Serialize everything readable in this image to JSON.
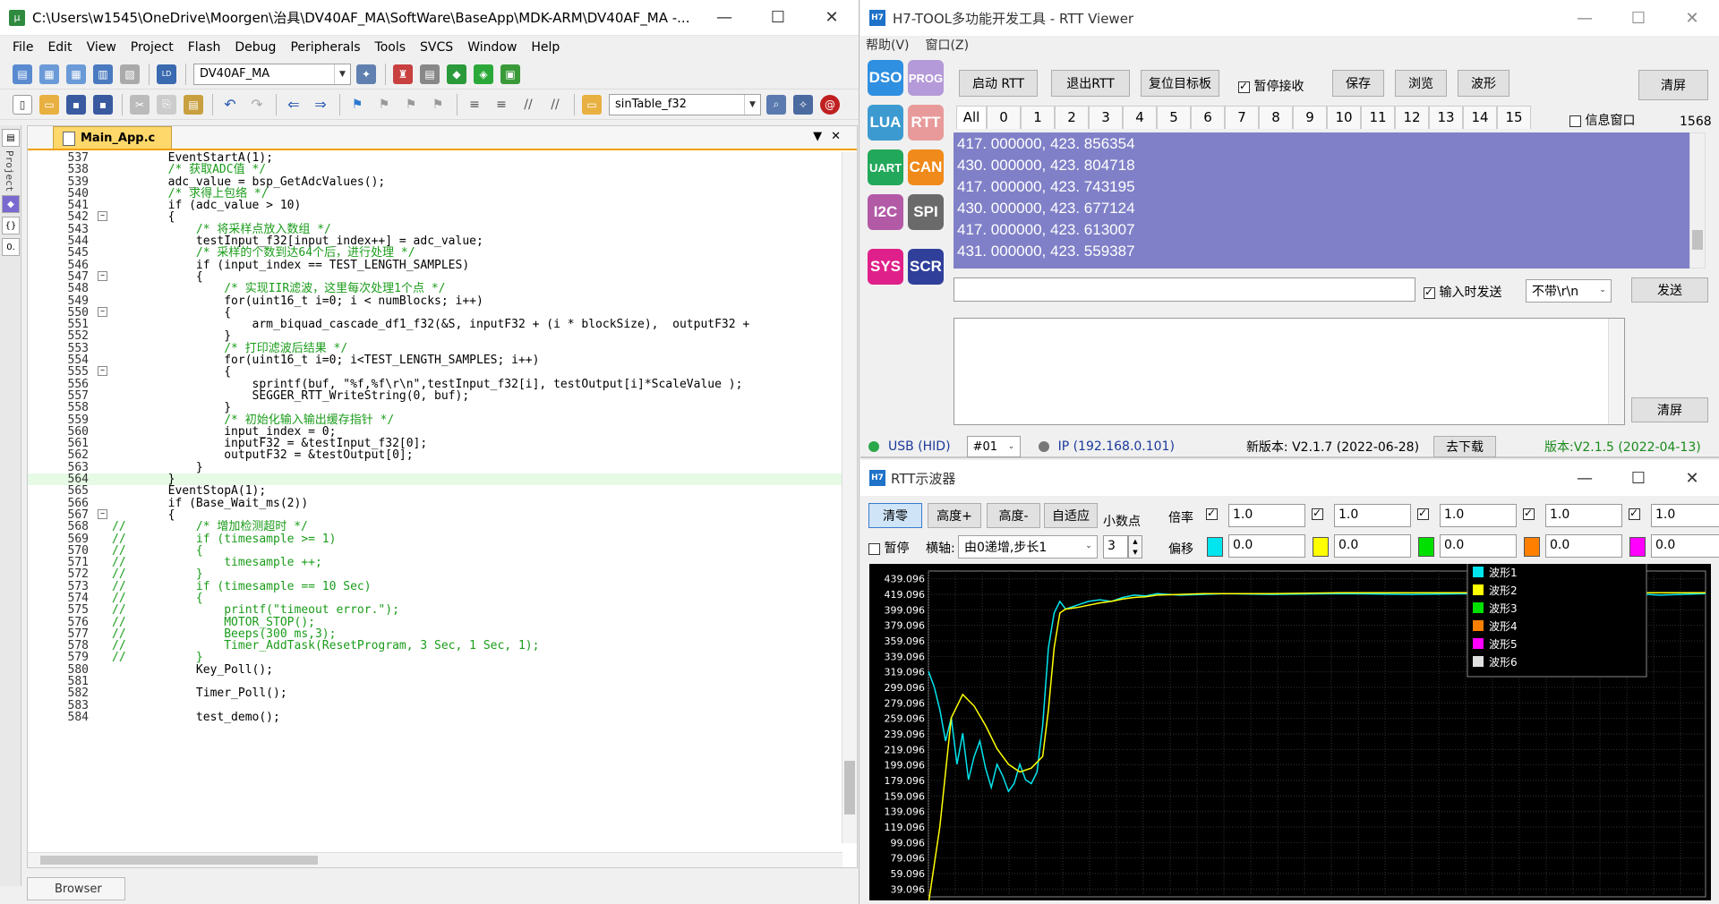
{
  "ide": {
    "title": "C:\\Users\\w1545\\OneDrive\\Moorgen\\治具\\DV40AF_MA\\SoftWare\\BaseApp\\MDK-ARM\\DV40AF_MA -...",
    "menu": [
      "File",
      "Edit",
      "View",
      "Project",
      "Flash",
      "Debug",
      "Peripherals",
      "Tools",
      "SVCS",
      "Window",
      "Help"
    ],
    "target": "DV40AF_MA",
    "find_combo": "sinTable_f32",
    "tab": "Main_App.c",
    "side_label": "Project",
    "browser_tab": "Browser",
    "code": [
      {
        "n": "537",
        "t": "        EventStartA(1);"
      },
      {
        "n": "538",
        "t": "        /* 获取ADC值 */"
      },
      {
        "n": "539",
        "t": "        adc_value = bsp_GetAdcValues();"
      },
      {
        "n": "540",
        "t": "        /* 求得上包络 */"
      },
      {
        "n": "541",
        "t": "        if (adc_value > 10)"
      },
      {
        "n": "542",
        "t": "        {",
        "f": 1
      },
      {
        "n": "543",
        "t": "            /* 将采样点放入数组 */"
      },
      {
        "n": "544",
        "t": "            testInput_f32[input_index++] = adc_value;"
      },
      {
        "n": "545",
        "t": "            /* 采样的个数到达64个后，进行处理 */"
      },
      {
        "n": "546",
        "t": "            if (input_index == TEST_LENGTH_SAMPLES)"
      },
      {
        "n": "547",
        "t": "            {",
        "f": 1
      },
      {
        "n": "548",
        "t": "                /* 实现IIR滤波，这里每次处理1个点 */"
      },
      {
        "n": "549",
        "t": "                for(uint16_t i=0; i < numBlocks; i++)"
      },
      {
        "n": "550",
        "t": "                {",
        "f": 1
      },
      {
        "n": "551",
        "t": "                    arm_biquad_cascade_df1_f32(&S, inputF32 + (i * blockSize),  outputF32 +"
      },
      {
        "n": "552",
        "t": "                }"
      },
      {
        "n": "553",
        "t": "                /* 打印滤波后结果 */"
      },
      {
        "n": "554",
        "t": "                for(uint16_t i=0; i<TEST_LENGTH_SAMPLES; i++)"
      },
      {
        "n": "555",
        "t": "                {",
        "f": 1
      },
      {
        "n": "556",
        "t": "                    sprintf(buf, \"%f,%f\\r\\n\",testInput_f32[i], testOutput[i]*ScaleValue );"
      },
      {
        "n": "557",
        "t": "                    SEGGER_RTT_WriteString(0, buf);"
      },
      {
        "n": "558",
        "t": "                }"
      },
      {
        "n": "559",
        "t": "                /* 初始化输入输出缓存指针 */"
      },
      {
        "n": "560",
        "t": "                input_index = 0;"
      },
      {
        "n": "561",
        "t": "                inputF32 = &testInput_f32[0];"
      },
      {
        "n": "562",
        "t": "                outputF32 = &testOutput[0];"
      },
      {
        "n": "563",
        "t": "            }"
      },
      {
        "n": "564",
        "t": "        }",
        "hl": 1
      },
      {
        "n": "565",
        "t": "        EventStopA(1);"
      },
      {
        "n": "566",
        "t": "        if (Base_Wait_ms(2))"
      },
      {
        "n": "567",
        "t": "        {",
        "f": 1
      },
      {
        "n": "568",
        "t": "//          /* 增加检测超时 */"
      },
      {
        "n": "569",
        "t": "//          if (timesample >= 1)"
      },
      {
        "n": "570",
        "t": "//          {"
      },
      {
        "n": "571",
        "t": "//              timesample ++;"
      },
      {
        "n": "572",
        "t": "//          }"
      },
      {
        "n": "573",
        "t": "//          if (timesample == 10 Sec)"
      },
      {
        "n": "574",
        "t": "//          {"
      },
      {
        "n": "575",
        "t": "//              printf(\"timeout error.\");"
      },
      {
        "n": "576",
        "t": "//              MOTOR_STOP();"
      },
      {
        "n": "577",
        "t": "//              Beeps(300 ms,3);"
      },
      {
        "n": "578",
        "t": "//              Timer_AddTask(ResetProgram, 3 Sec, 1 Sec, 1);"
      },
      {
        "n": "579",
        "t": "//          }"
      },
      {
        "n": "580",
        "t": "            Key_Poll();"
      },
      {
        "n": "581",
        "t": ""
      },
      {
        "n": "582",
        "t": "            Timer_Poll();"
      },
      {
        "n": "583",
        "t": ""
      },
      {
        "n": "584",
        "t": "            test_demo();"
      }
    ]
  },
  "rtt": {
    "title": "H7-TOOL多功能开发工具 - RTT Viewer",
    "menu": [
      "帮助(V)",
      "窗口(Z)"
    ],
    "side_buttons": [
      {
        "label": "DSO",
        "color": "#2f8fe0"
      },
      {
        "label": "PROG",
        "color": "#b49ad8"
      },
      {
        "label": "LUA",
        "color": "#3d9ad0"
      },
      {
        "label": "RTT",
        "color": "#e89a9a"
      },
      {
        "label": "UART",
        "color": "#22a85a"
      },
      {
        "label": "CAN",
        "color": "#f08a1a"
      },
      {
        "label": "I2C",
        "color": "#b25aa6"
      },
      {
        "label": "SPI",
        "color": "#6a6a6a"
      },
      {
        "label": "SYS",
        "color": "#e0208a"
      },
      {
        "label": "SCR",
        "color": "#2f3f9a"
      }
    ],
    "btn_start": "启动 RTT",
    "btn_exit": "退出RTT",
    "btn_reset": "复位目标板",
    "pause_recv": "暂停接收",
    "btn_save": "保存",
    "btn_browse": "浏览",
    "btn_wave": "波形",
    "btn_clear": "清屏",
    "tabs": [
      "All",
      "0",
      "1",
      "2",
      "3",
      "4",
      "5",
      "6",
      "7",
      "8",
      "9",
      "10",
      "11",
      "12",
      "13",
      "14",
      "15"
    ],
    "info_window": "信息窗口",
    "count": "1568",
    "log": [
      "417. 000000, 423. 856354",
      "430. 000000, 423. 804718",
      "417. 000000, 423. 743195",
      "430. 000000, 423. 677124",
      "417. 000000, 423. 613007",
      "431. 000000, 423. 559387"
    ],
    "send_on_input": "输入时发送",
    "line_ending": "不带\\r\\n",
    "btn_send": "发送",
    "btn_clear2": "清屏",
    "usb_status": "USB (HID)",
    "port": "#01",
    "ip_status": "IP (192.168.0.101)",
    "new_version": "新版本: V2.1.7 (2022-06-28)",
    "btn_download": "去下载",
    "version": "版本:V2.1.5 (2022-04-13)",
    "usb_color": "#2aa84a",
    "ip_color": "#777777",
    "version_color": "#1a8a1a"
  },
  "osc": {
    "title": "RTT示波器",
    "btn_zero": "清零",
    "btn_hplus": "高度+",
    "btn_hminus": "高度-",
    "btn_auto": "自适应",
    "decimal_label": "小数点",
    "decimal_value": "3",
    "pause": "暂停",
    "axis_label": "横轴:",
    "axis_mode": "由0递增,步长1",
    "scale_label": "倍率",
    "offset_label": "偏移",
    "channels": [
      {
        "scale": "1.0",
        "offset": "0.0",
        "color": "#00e5ee"
      },
      {
        "scale": "1.0",
        "offset": "0.0",
        "color": "#ffff00"
      },
      {
        "scale": "1.0",
        "offset": "0.0",
        "color": "#00e000"
      },
      {
        "scale": "1.0",
        "offset": "0.0",
        "color": "#ff8000"
      },
      {
        "scale": "1.0",
        "offset": "0.0",
        "color": "#ff00ff"
      }
    ],
    "legend": [
      {
        "name": "波形1",
        "color": "#00e5ee"
      },
      {
        "name": "波形2",
        "color": "#ffff00"
      },
      {
        "name": "波形3",
        "color": "#00e000"
      },
      {
        "name": "波形4",
        "color": "#ff8000"
      },
      {
        "name": "波形5",
        "color": "#ff00ff"
      },
      {
        "name": "波形6",
        "color": "#e0e0e0"
      }
    ]
  },
  "chart_data": {
    "type": "line",
    "yticks": [
      "439.096",
      "419.096",
      "399.096",
      "379.096",
      "359.096",
      "339.096",
      "319.096",
      "299.096",
      "279.096",
      "259.096",
      "239.096",
      "219.096",
      "199.096",
      "179.096",
      "159.096",
      "139.096",
      "119.096",
      "99.096",
      "79.096",
      "59.096",
      "39.096"
    ],
    "ylim": [
      29.096,
      449.096
    ],
    "xlim": [
      0,
      680
    ],
    "series": [
      {
        "name": "波形1",
        "color": "#00e5ee",
        "x": [
          0,
          5,
          10,
          15,
          20,
          25,
          30,
          35,
          40,
          45,
          50,
          55,
          60,
          65,
          70,
          75,
          80,
          85,
          90,
          95,
          100,
          105,
          110,
          115,
          120,
          130,
          140,
          150,
          160,
          170,
          180,
          190,
          200,
          220,
          240,
          260,
          300,
          360,
          420,
          480,
          540,
          600,
          640,
          680
        ],
        "y": [
          320,
          300,
          270,
          230,
          260,
          200,
          240,
          180,
          210,
          230,
          195,
          170,
          200,
          185,
          165,
          175,
          200,
          180,
          175,
          190,
          250,
          350,
          395,
          410,
          400,
          405,
          410,
          412,
          410,
          415,
          418,
          417,
          420,
          418,
          419,
          420,
          419,
          420,
          419,
          420,
          419,
          421,
          418,
          420
        ]
      },
      {
        "name": "波形2",
        "color": "#ffff00",
        "x": [
          0,
          10,
          20,
          30,
          40,
          50,
          60,
          70,
          80,
          90,
          100,
          105,
          110,
          115,
          120,
          130,
          140,
          150,
          160,
          170,
          180,
          190,
          200,
          220,
          240,
          260,
          300,
          360,
          420,
          480,
          540,
          600,
          640,
          680
        ],
        "y": [
          20,
          120,
          260,
          290,
          275,
          250,
          220,
          200,
          190,
          195,
          210,
          270,
          350,
          395,
          400,
          402,
          405,
          408,
          410,
          413,
          415,
          416,
          418,
          419,
          420,
          420,
          420,
          421,
          421,
          421,
          421,
          421,
          421,
          421
        ]
      }
    ]
  }
}
